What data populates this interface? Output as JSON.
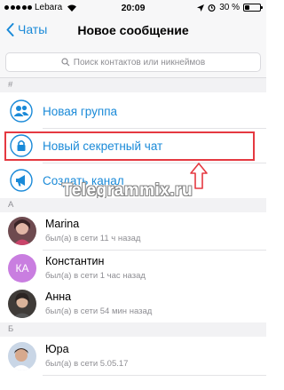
{
  "status_bar": {
    "carrier": "Lebara",
    "time": "20:09",
    "battery_percent": "30 %",
    "battery_level": 0.3
  },
  "nav": {
    "back_label": "Чаты",
    "title": "Новое сообщение"
  },
  "search": {
    "placeholder": "Поиск контактов или никнеймов"
  },
  "sections": {
    "hash": "#",
    "a": "А",
    "b": "Б"
  },
  "actions": [
    {
      "label": "Новая группа",
      "icon": "group-icon"
    },
    {
      "label": "Новый секретный чат",
      "icon": "lock-icon"
    },
    {
      "label": "Создать канал",
      "icon": "megaphone-icon"
    }
  ],
  "watermark": "Telegrammix.ru",
  "contacts": [
    {
      "name": "Marina",
      "status": "был(а) в сети 11 ч назад",
      "avatar": "photo"
    },
    {
      "name": "Константин",
      "status": "был(а) в сети 1 час назад",
      "avatar_initials": "КА"
    },
    {
      "name": "Анна",
      "status": "был(а) в сети 54 мин назад",
      "avatar": "photo"
    },
    {
      "name": "Юра",
      "status": "был(а) в сети 5.05.17",
      "avatar": "photo"
    }
  ],
  "colors": {
    "accent": "#1a8ad8",
    "highlight": "#e53941",
    "initials_avatar": "#c97ee0"
  }
}
